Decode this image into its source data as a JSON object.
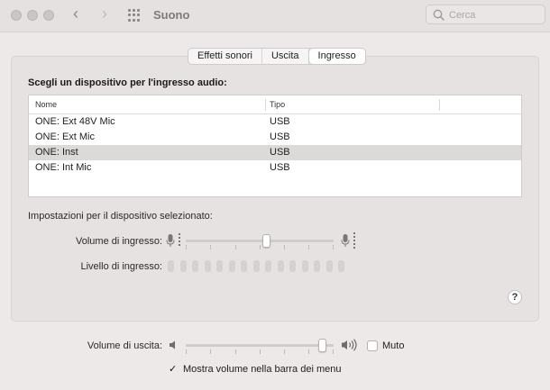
{
  "window": {
    "title": "Suono",
    "search_placeholder": "Cerca"
  },
  "tabs": [
    {
      "label": "Effetti sonori",
      "active": false
    },
    {
      "label": "Uscita",
      "active": false
    },
    {
      "label": "Ingresso",
      "active": true
    }
  ],
  "input_section": {
    "title": "Scegli un dispositivo per l'ingresso audio:",
    "columns": [
      "Nome",
      "Tipo"
    ],
    "devices": [
      {
        "name": "ONE: Ext 48V Mic",
        "type": "USB",
        "selected": false
      },
      {
        "name": "ONE: Ext Mic",
        "type": "USB",
        "selected": false
      },
      {
        "name": "ONE: Inst",
        "type": "USB",
        "selected": true
      },
      {
        "name": "ONE: Int Mic",
        "type": "USB",
        "selected": false
      }
    ]
  },
  "settings": {
    "title": "Impostazioni per il dispositivo selezionato:",
    "input_volume_label": "Volume di ingresso:",
    "input_volume_fraction": 0.55,
    "input_level_label": "Livello di ingresso:",
    "input_level_lit_segments": 0,
    "input_level_segments": 15
  },
  "output": {
    "volume_label": "Volume di uscita:",
    "volume_fraction": 0.95,
    "mute_label": "Muto",
    "mute_checked": false,
    "show_volume_label": "Mostra volume nella barra dei menu",
    "show_volume_checked": true
  },
  "help_label": "?",
  "icons": {
    "search": "search-icon",
    "mic_low": "microphone-low-icon",
    "mic_high": "microphone-high-icon",
    "speaker_low": "speaker-low-icon",
    "speaker_high": "speaker-high-icon"
  }
}
